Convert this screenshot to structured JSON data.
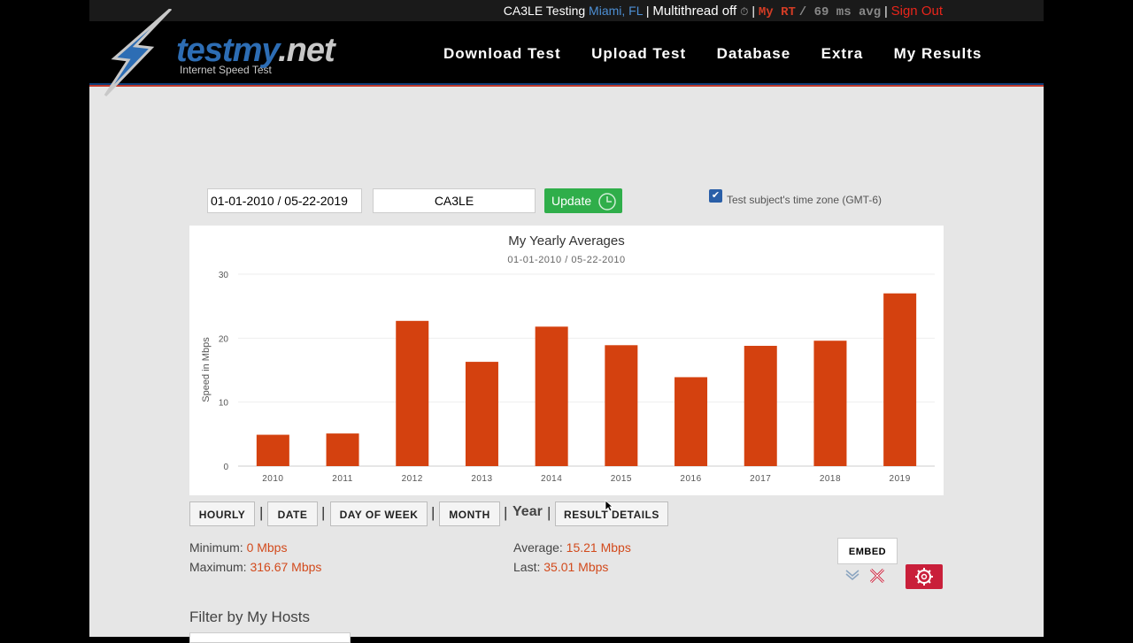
{
  "topbar": {
    "testing_label": "CA3LE Testing",
    "location": "Miami, FL",
    "multithread": "Multithread off",
    "rt_label": "My RT",
    "rt_value": "/ 69 ms avg",
    "sign_out": "Sign Out",
    "pipe": "|"
  },
  "logo": {
    "name": "testmy",
    "tld": ".net",
    "tagline": "Internet Speed Test"
  },
  "nav": [
    "Download Test",
    "Upload Test",
    "Database",
    "Extra",
    "My Results"
  ],
  "controls": {
    "date_range": "01-01-2010 / 05-22-2019",
    "host": "CA3LE",
    "update_label": "Update",
    "tz_label": "Test subject's time zone (GMT-6)",
    "tz_checked": true
  },
  "chart_data": {
    "type": "bar",
    "title": "My Yearly Averages",
    "subtitle": "01-01-2010 / 05-22-2010",
    "ylabel": "Speed in Mbps",
    "xlabel": "",
    "categories": [
      "2010",
      "2011",
      "2012",
      "2013",
      "2014",
      "2015",
      "2016",
      "2017",
      "2018",
      "2019"
    ],
    "values": [
      4.9,
      5.1,
      22.7,
      16.3,
      21.8,
      18.9,
      13.9,
      18.8,
      19.6,
      27.0
    ],
    "yticks": [
      0,
      10,
      20,
      30
    ],
    "ylim": [
      0,
      30
    ],
    "bar_color": "#d4410f",
    "grid": true
  },
  "view_buttons": {
    "hourly": "HOURLY",
    "date": "DATE",
    "day_of_week": "DAY OF WEEK",
    "month": "MONTH",
    "year": "Year",
    "result_details": "RESULT DETAILS",
    "sep": "|"
  },
  "stats": {
    "minimum_label": "Minimum:",
    "minimum_value": "0 Mbps",
    "maximum_label": "Maximum:",
    "maximum_value": "316.67 Mbps",
    "average_label": "Average:",
    "average_value": "15.21 Mbps",
    "last_label": "Last:",
    "last_value": "35.01 Mbps"
  },
  "embed_label": "EMBED",
  "filter_title": "Filter by My Hosts",
  "colors": {
    "accent_red": "#d24a1c",
    "update_green": "#2fae4a",
    "brand_blue": "#2d6db4"
  }
}
